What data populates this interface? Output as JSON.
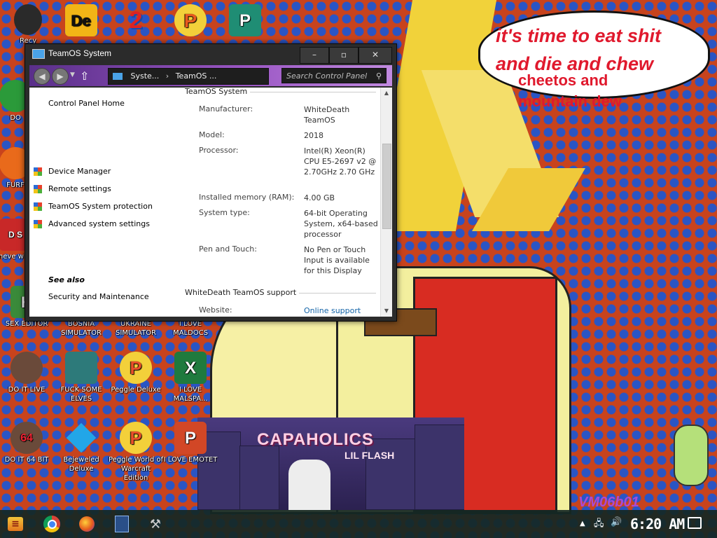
{
  "wallpaper": {
    "speech_lines": [
      "it's time to eat shit",
      "and die and chew",
      "cheetos and",
      "mountain dew"
    ],
    "album": {
      "title": "CAPAHOLICS",
      "subtitle": "LIL FLASH"
    },
    "watermark": "VM06b01"
  },
  "desktop_icons": [
    {
      "label": "Recy",
      "letter": "",
      "color": "#2a2a2a"
    },
    {
      "label": "",
      "letter": "De",
      "color": "#f2b516"
    },
    {
      "label": "",
      "letter": "2",
      "color": "#1b4aa8"
    },
    {
      "label": "",
      "letter": "P",
      "color": "#e85a1e"
    },
    {
      "label": "",
      "letter": "P",
      "color": "#1f8d74"
    },
    {
      "label": "DO",
      "letter": "",
      "color": "#2b9a3a"
    },
    {
      "label": "FURF",
      "letter": "",
      "color": "#e96a1b"
    },
    {
      "label": "neve why",
      "letter": "D S",
      "color": "#c82828"
    },
    {
      "label": "SEX EDITOR",
      "letter": "H",
      "color": "#3a8a3a"
    },
    {
      "label": "BOSNIA SIMULATOR",
      "letter": "",
      "color": "#444"
    },
    {
      "label": "UKRAINE SIMULATOR",
      "letter": "",
      "color": "#444"
    },
    {
      "label": "I LOVE MALDOCS",
      "letter": "",
      "color": "#444"
    },
    {
      "label": "DO IT LIVE",
      "letter": "",
      "color": "#6a4a3a"
    },
    {
      "label": "FUCK SOME ELVES",
      "letter": "",
      "color": "#2d7a7a"
    },
    {
      "label": "Peggle Deluxe",
      "letter": "P",
      "color": "#e84f2a"
    },
    {
      "label": "I LOVE MALSPA...",
      "letter": "X",
      "color": "#1f7a3e"
    },
    {
      "label": "DO IT 64 BIT",
      "letter": "64",
      "color": "#6a4a3a"
    },
    {
      "label": "Bejeweled Deluxe",
      "letter": "",
      "color": "#22a6e8"
    },
    {
      "label": "Peggle World of Warcraft Edition",
      "letter": "P",
      "color": "#e84f2a"
    },
    {
      "label": "I LOVE EMOTET",
      "letter": "P",
      "color": "#d24726"
    }
  ],
  "window": {
    "title": "TeamOS System",
    "controls": {
      "min": "–",
      "max": "▫",
      "close": "✕"
    },
    "address": {
      "crumb1": "Syste...",
      "crumb2": "TeamOS ..."
    },
    "search_placeholder": "Search Control Panel",
    "left_pane": {
      "home": "Control Panel Home",
      "items": [
        "Device Manager",
        "Remote settings",
        "TeamOS System protection",
        "Advanced system settings"
      ],
      "see_also": "See also",
      "security": "Security and Maintenance"
    },
    "system_section": "TeamOS System",
    "rows": [
      {
        "label": "Manufacturer:",
        "value": "WhiteDeath TeamOS"
      },
      {
        "label": "Model:",
        "value": "2018"
      },
      {
        "label": "Processor:",
        "value": "Intel(R) Xeon(R) CPU E5-2697 v2 @ 2.70GHz   2.70 GHz"
      },
      {
        "label": "Installed memory (RAM):",
        "value": "4.00 GB"
      },
      {
        "label": "System type:",
        "value": "64-bit Operating System, x64-based processor"
      },
      {
        "label": "Pen and Touch:",
        "value": "No Pen or Touch Input is available for this Display"
      }
    ],
    "support_section": "WhiteDeath TeamOS support",
    "website_label": "Website:",
    "website_value": "Online support"
  },
  "taskbar": {
    "clock": "6:20 AM",
    "tray_arrow": "▲",
    "network_icon": "network-icon",
    "volume_icon": "volume-icon"
  }
}
